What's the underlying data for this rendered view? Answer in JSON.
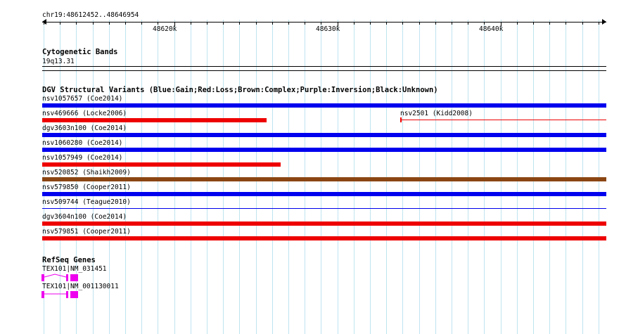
{
  "ruler": {
    "range_label": "chr19:48612452..48646954",
    "tick_labels": [
      "48620k",
      "48630k",
      "48640k"
    ]
  },
  "cytoband": {
    "title": "Cytogenetic Bands",
    "band_label": "19q13.31"
  },
  "dgv": {
    "title": "DGV Structural Variants (Blue:Gain;Red:Loss;Brown:Complex;Purple:Inversion;Black:Unknown)",
    "colors": {
      "gain": "#0000ee",
      "loss": "#ee0000",
      "complex": "#8b4513"
    },
    "variants": [
      {
        "label": "nsv1057657 (Coe2014)",
        "type": "gain"
      },
      {
        "label": "nsv469666 (Locke2006)",
        "type": "loss"
      },
      {
        "label": "nsv2501 (Kidd2008)",
        "type": "loss"
      },
      {
        "label": "dgv3603n100 (Coe2014)",
        "type": "gain"
      },
      {
        "label": "nsv1060280 (Coe2014)",
        "type": "gain"
      },
      {
        "label": "nsv1057949 (Coe2014)",
        "type": "loss"
      },
      {
        "label": "nsv520852 (Shaikh2009)",
        "type": "complex"
      },
      {
        "label": "nsv579850 (Cooper2011)",
        "type": "gain"
      },
      {
        "label": "nsv509744 (Teague2010)",
        "type": "gain"
      },
      {
        "label": "dgv3604n100 (Coe2014)",
        "type": "loss"
      },
      {
        "label": "nsv579851 (Cooper2011)",
        "type": "loss"
      }
    ]
  },
  "refseq": {
    "title": "RefSeq Genes",
    "gene_color": "#ee00ee",
    "genes": [
      {
        "label": "TEX101|NM_031451"
      },
      {
        "label": "TEX101|NM_001130011"
      }
    ]
  }
}
